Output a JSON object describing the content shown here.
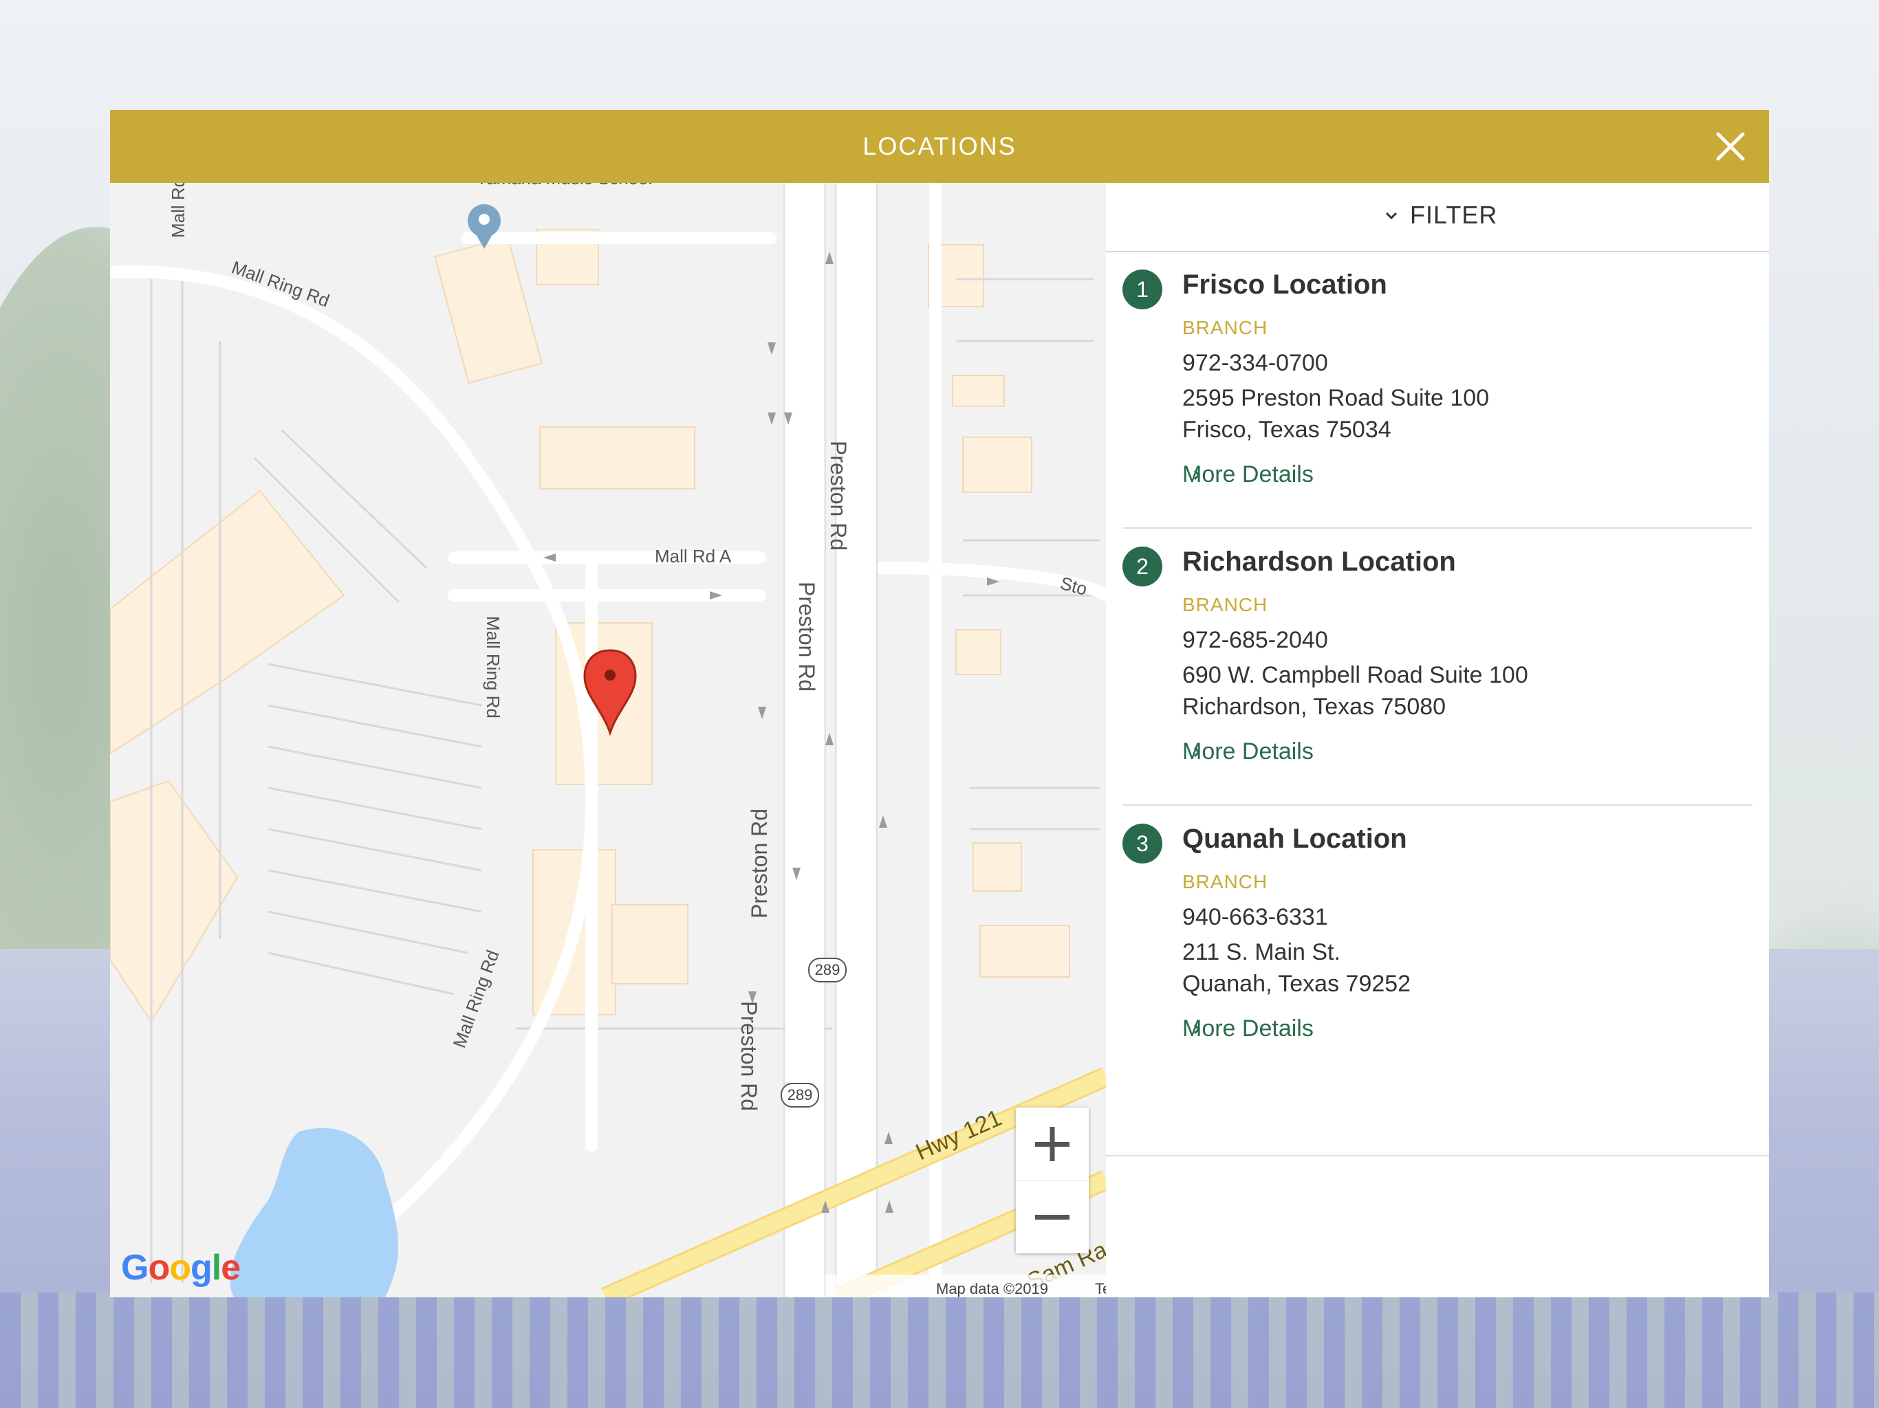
{
  "header": {
    "title": "LOCATIONS"
  },
  "filter": {
    "label": "FILTER"
  },
  "locations": [
    {
      "number": "1",
      "name": "Frisco Location",
      "type": "BRANCH",
      "phone": "972-334-0700",
      "address_line1": "2595 Preston Road Suite 100",
      "address_line2": "Frisco, Texas 75034",
      "link": "More Details"
    },
    {
      "number": "2",
      "name": "Richardson Location",
      "type": "BRANCH",
      "phone": "972-685-2040",
      "address_line1": "690 W. Campbell Road Suite 100",
      "address_line2": "Richardson, Texas 75080",
      "link": "More Details"
    },
    {
      "number": "3",
      "name": "Quanah Location",
      "type": "BRANCH",
      "phone": "940-663-6331",
      "address_line1": "211 S. Main St.",
      "address_line2": "Quanah, Texas 79252",
      "link": "More Details"
    }
  ],
  "map": {
    "labels": {
      "poi": "Yamaha Music School",
      "mall_ring_rd": "Mall Ring Rd",
      "mall_rd": "Mall Rd",
      "mall_rd_a": "Mall Rd A",
      "preston_rd": "Preston Rd",
      "hwy_121": "Hwy 121",
      "sam_rayburn": "Sam Ra",
      "stonebrook": "Sto",
      "route_289": "289"
    },
    "footer": {
      "map_data": "Map data ©2019",
      "terms": "Terms of Use"
    },
    "logo": [
      "G",
      "o",
      "o",
      "g",
      "l",
      "e"
    ],
    "logo_colors": [
      "#4285f4",
      "#ea4335",
      "#fbbc05",
      "#4285f4",
      "#34a853",
      "#ea4335"
    ],
    "zoom_in": "+",
    "zoom_out": "−"
  },
  "colors": {
    "header": "#c8aa36",
    "accent_green": "#2a6a4c",
    "branch_gold": "#c8aa36",
    "map_water": "#a9d3f8",
    "map_highway": "#fbeb9f",
    "map_building": "#fdf0dd"
  },
  "icons": {
    "close": "close-icon",
    "filter": "chevron-down-icon",
    "more": "chevron-right-icon",
    "marker": "map-marker-icon"
  }
}
